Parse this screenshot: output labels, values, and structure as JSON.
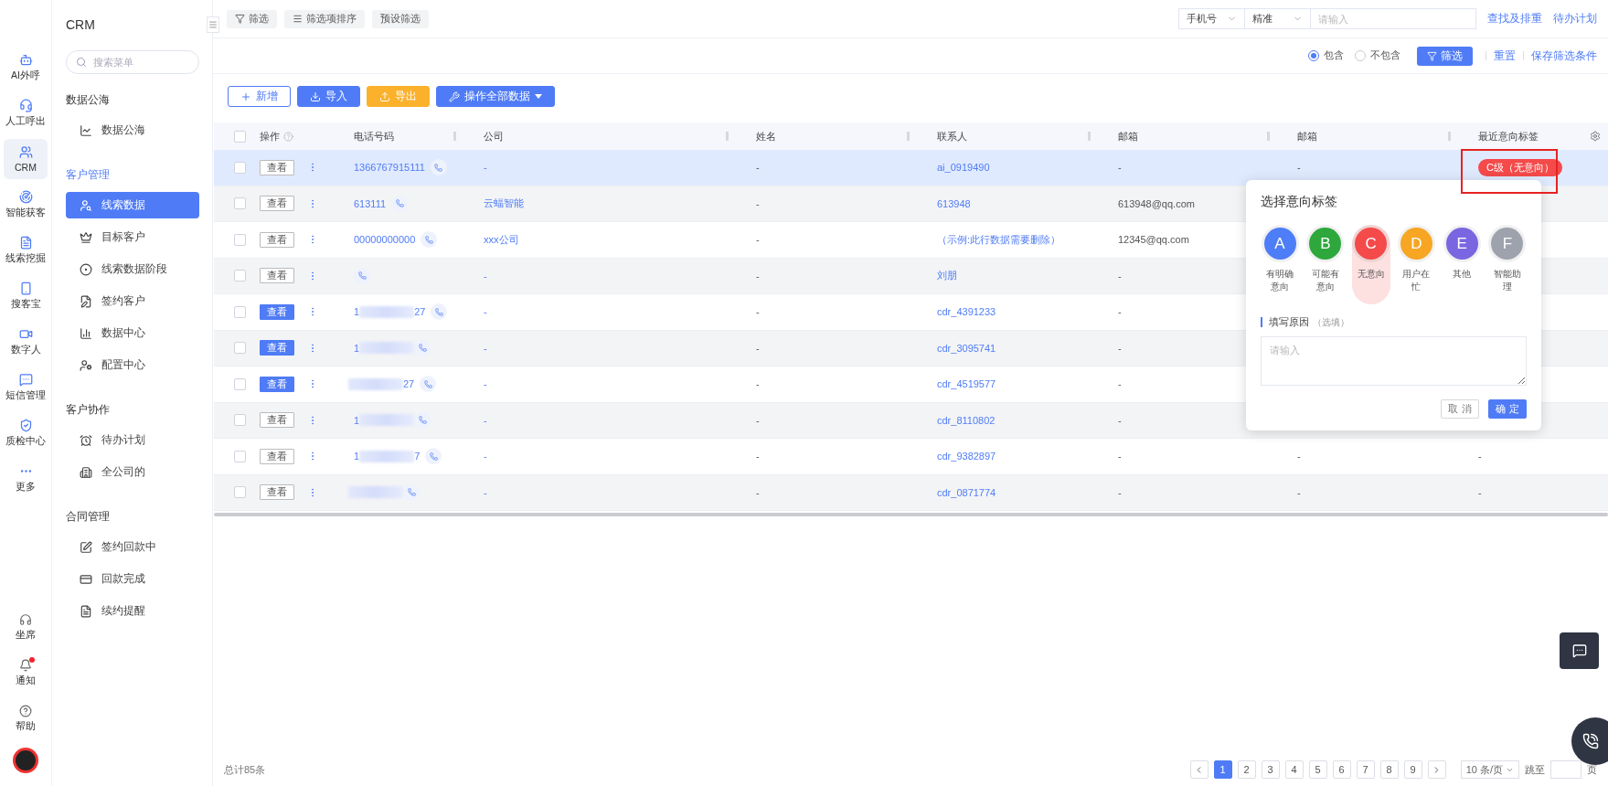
{
  "rail": {
    "items": [
      {
        "label": "AI外呼",
        "selected": false
      },
      {
        "label": "人工呼出",
        "selected": false
      },
      {
        "label": "CRM",
        "selected": true
      },
      {
        "label": "智能获客",
        "selected": false
      },
      {
        "label": "线索挖掘",
        "selected": false
      },
      {
        "label": "搜客宝",
        "selected": false
      },
      {
        "label": "数字人",
        "selected": false
      },
      {
        "label": "短信管理",
        "selected": false
      },
      {
        "label": "质检中心",
        "selected": false
      },
      {
        "label": "更多",
        "selected": false
      }
    ],
    "bottom": [
      {
        "label": "坐席",
        "unread": false
      },
      {
        "label": "通知",
        "unread": true
      },
      {
        "label": "帮助",
        "unread": false
      }
    ]
  },
  "menu": {
    "title": "CRM",
    "search": {
      "placeholder": "搜索菜单"
    },
    "groups": [
      {
        "title": "数据公海",
        "active": false,
        "items": [
          {
            "label": "数据公海",
            "selected": false
          }
        ]
      },
      {
        "title": "客户管理",
        "active": true,
        "items": [
          {
            "label": "线索数据",
            "selected": true
          },
          {
            "label": "目标客户",
            "selected": false
          },
          {
            "label": "线索数据阶段",
            "selected": false
          },
          {
            "label": "签约客户",
            "selected": false
          },
          {
            "label": "数据中心",
            "selected": false
          },
          {
            "label": "配置中心",
            "selected": false
          }
        ]
      },
      {
        "title": "客户协作",
        "active": false,
        "items": [
          {
            "label": "待办计划",
            "selected": false
          },
          {
            "label": "全公司的",
            "selected": false
          }
        ]
      },
      {
        "title": "合同管理",
        "active": false,
        "items": [
          {
            "label": "签约回款中",
            "selected": false
          },
          {
            "label": "回款完成",
            "selected": false
          },
          {
            "label": "续约提醒",
            "selected": false
          }
        ]
      }
    ]
  },
  "filter_bar": {
    "buttons": [
      "筛选",
      "筛选项排序",
      "预设筛选"
    ],
    "field_select": "手机号",
    "match_select": "精准",
    "search": {
      "placeholder": "请输入"
    },
    "links": [
      "查找及排重",
      "待办计划"
    ]
  },
  "filter_options": {
    "radios": [
      {
        "label": "包含",
        "selected": true
      },
      {
        "label": "不包含",
        "selected": false
      }
    ],
    "apply": "筛选",
    "links": [
      "重置",
      "保存筛选条件"
    ]
  },
  "toolbar": [
    {
      "label": "新增",
      "kind": "outline"
    },
    {
      "label": "导入",
      "kind": "import"
    },
    {
      "label": "导出",
      "kind": "export"
    },
    {
      "label": "操作全部数据",
      "kind": "dropdown"
    }
  ],
  "table": {
    "select_all": {
      "checked": false
    },
    "columns": [
      "操作",
      "电话号码",
      "公司",
      "姓名",
      "联系人",
      "邮箱",
      "邮箱",
      "最近意向标签"
    ],
    "rows": [
      {
        "selected": true,
        "checked": false,
        "view": {
          "label": "查看",
          "primary": false
        },
        "phone": {
          "start": "1366767915111",
          "redacted": false
        },
        "company": "-",
        "name": "-",
        "contact": "ai_0919490",
        "email": "-",
        "email_2": "-",
        "tag": "C级（无意向）"
      },
      {
        "selected": false,
        "checked": false,
        "view": {
          "label": "查看",
          "primary": false
        },
        "phone": {
          "start": "613111",
          "redacted": false
        },
        "company": "云蝠智能",
        "name": "-",
        "contact": "613948",
        "email": "613948@qq.com"
      },
      {
        "selected": false,
        "checked": false,
        "view": {
          "label": "查看",
          "primary": false
        },
        "phone": {
          "start": "00000000000",
          "redacted": false
        },
        "company": "xxx公司",
        "name": "-",
        "contact": "（示例:此行数据需要删除）",
        "email": "12345@qq.com"
      },
      {
        "selected": false,
        "checked": false,
        "view": {
          "label": "查看",
          "primary": false
        },
        "phone": {
          "redacted": false
        },
        "company": "-",
        "name": "-",
        "contact": "刘朋",
        "email": "-"
      },
      {
        "selected": false,
        "checked": false,
        "view": {
          "label": "查看",
          "primary": true
        },
        "phone": {
          "start": "1",
          "end": "27",
          "redacted": true
        },
        "company": "-",
        "name": "-",
        "contact": "cdr_4391233",
        "email": "-"
      },
      {
        "selected": false,
        "checked": false,
        "view": {
          "label": "查看",
          "primary": true
        },
        "phone": {
          "start": "1",
          "redacted": true
        },
        "company": "-",
        "name": "-",
        "contact": "cdr_3095741",
        "email": "-"
      },
      {
        "selected": false,
        "checked": false,
        "view": {
          "label": "查看",
          "primary": true
        },
        "phone": {
          "end": "27",
          "redacted": true
        },
        "company": "-",
        "name": "-",
        "contact": "cdr_4519577",
        "email": "-"
      },
      {
        "selected": false,
        "checked": false,
        "view": {
          "label": "查看",
          "primary": false
        },
        "phone": {
          "start": "1",
          "redacted": true
        },
        "company": "-",
        "name": "-",
        "contact": "cdr_8110802",
        "email": "-"
      },
      {
        "selected": false,
        "checked": false,
        "view": {
          "label": "查看",
          "primary": false
        },
        "phone": {
          "start": "1",
          "end": "7",
          "redacted": true
        },
        "company": "-",
        "name": "-",
        "contact": "cdr_9382897",
        "email": "-",
        "email_2": "-",
        "tag": "-"
      },
      {
        "selected": false,
        "checked": false,
        "view": {
          "label": "查看",
          "primary": false
        },
        "phone": {
          "redacted": true
        },
        "company": "-",
        "name": "-",
        "contact": "cdr_0871774",
        "email": "-",
        "email_2": "-",
        "tag": "-"
      }
    ]
  },
  "intent_popup": {
    "title": "选择意向标签",
    "options": [
      {
        "letter": "A",
        "label": "有明确意向",
        "color": "#4d7df7",
        "selected": false
      },
      {
        "letter": "B",
        "label": "可能有意向",
        "color": "#2ea83d",
        "selected": false
      },
      {
        "letter": "C",
        "label": "无意向",
        "color": "#f44a4a",
        "selected": true
      },
      {
        "letter": "D",
        "label": "用户在忙",
        "color": "#f6a623",
        "selected": false
      },
      {
        "letter": "E",
        "label": "其他",
        "color": "#7a66e0",
        "selected": false
      },
      {
        "letter": "F",
        "label": "智能助理",
        "color": "#9da2ad",
        "selected": false
      }
    ],
    "reason_label": "填写原因",
    "reason_hint": "（选填）",
    "reason_placeholder": "请输入",
    "cancel": "取 消",
    "confirm": "确 定"
  },
  "pagination": {
    "total": "总计85条",
    "pages": [
      {
        "label": "1",
        "selected": true
      },
      {
        "label": "2",
        "selected": false
      },
      {
        "label": "3",
        "selected": false
      },
      {
        "label": "4",
        "selected": false
      },
      {
        "label": "5",
        "selected": false
      },
      {
        "label": "6",
        "selected": false
      },
      {
        "label": "7",
        "selected": false
      },
      {
        "label": "8",
        "selected": false
      },
      {
        "label": "9",
        "selected": false
      }
    ],
    "page_size": "10 条/页",
    "jump_label": "跳至",
    "page_unit": "页"
  }
}
